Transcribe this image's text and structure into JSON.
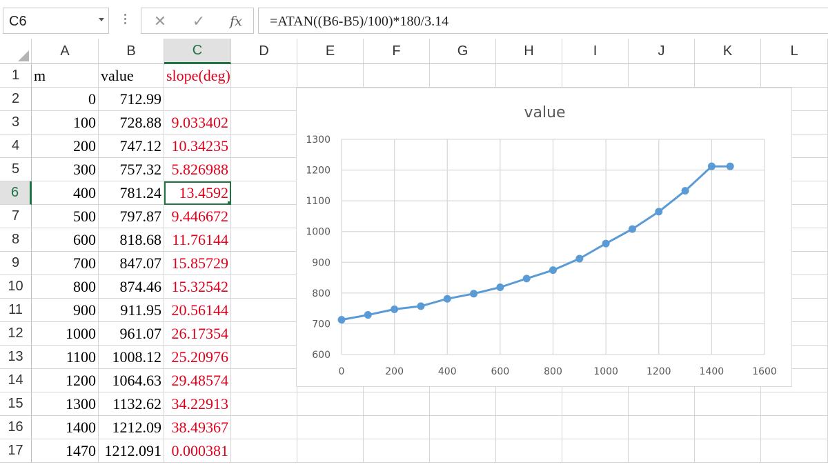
{
  "formula_bar": {
    "name_box": "C6",
    "cancel_glyph": "✕",
    "enter_glyph": "✓",
    "fx_label": "fx",
    "formula": "=ATAN((B6-B5)/100)*180/3.14"
  },
  "columns": [
    "A",
    "B",
    "C",
    "D",
    "E",
    "F",
    "G",
    "H",
    "I",
    "J",
    "K",
    "L"
  ],
  "active_column": "C",
  "rows": [
    "1",
    "2",
    "3",
    "4",
    "5",
    "6",
    "7",
    "8",
    "9",
    "10",
    "11",
    "12",
    "13",
    "14",
    "15",
    "16",
    "17"
  ],
  "active_row": "6",
  "headers": {
    "a": "m",
    "b": "value",
    "c": "slope(deg)"
  },
  "data": [
    {
      "a": "0",
      "b": "712.99",
      "c": ""
    },
    {
      "a": "100",
      "b": "728.88",
      "c": "9.033402"
    },
    {
      "a": "200",
      "b": "747.12",
      "c": "10.34235"
    },
    {
      "a": "300",
      "b": "757.32",
      "c": "5.826988"
    },
    {
      "a": "400",
      "b": "781.24",
      "c": "13.4592"
    },
    {
      "a": "500",
      "b": "797.87",
      "c": "9.446672"
    },
    {
      "a": "600",
      "b": "818.68",
      "c": "11.76144"
    },
    {
      "a": "700",
      "b": "847.07",
      "c": "15.85729"
    },
    {
      "a": "800",
      "b": "874.46",
      "c": "15.32542"
    },
    {
      "a": "900",
      "b": "911.95",
      "c": "20.56144"
    },
    {
      "a": "1000",
      "b": "961.07",
      "c": "26.17354"
    },
    {
      "a": "1100",
      "b": "1008.12",
      "c": "25.20976"
    },
    {
      "a": "1200",
      "b": "1064.63",
      "c": "29.48574"
    },
    {
      "a": "1300",
      "b": "1132.62",
      "c": "34.22913"
    },
    {
      "a": "1400",
      "b": "1212.09",
      "c": "38.49367"
    },
    {
      "a": "1470",
      "b": "1212.091",
      "c": "0.000381"
    }
  ],
  "colors": {
    "accent": "#217346",
    "red_text": "#e0001b",
    "series": "#5b9bd5",
    "chart_grid": "#d9d9d9"
  },
  "chart_data": {
    "type": "line",
    "title": "value",
    "xlabel": "",
    "ylabel": "",
    "x": [
      0,
      100,
      200,
      300,
      400,
      500,
      600,
      700,
      800,
      900,
      1000,
      1100,
      1200,
      1300,
      1400,
      1470
    ],
    "series": [
      {
        "values": [
          712.99,
          728.88,
          747.12,
          757.32,
          781.24,
          797.87,
          818.68,
          847.07,
          874.46,
          911.95,
          961.07,
          1008.12,
          1064.63,
          1132.62,
          1212.09,
          1212.091
        ]
      }
    ],
    "xlim": [
      0,
      1600
    ],
    "ylim": [
      600,
      1300
    ],
    "xticks": [
      0,
      200,
      400,
      600,
      800,
      1000,
      1200,
      1400,
      1600
    ],
    "yticks": [
      600,
      700,
      800,
      900,
      1000,
      1100,
      1200,
      1300
    ],
    "grid": true,
    "legend": "none",
    "markers": true
  }
}
